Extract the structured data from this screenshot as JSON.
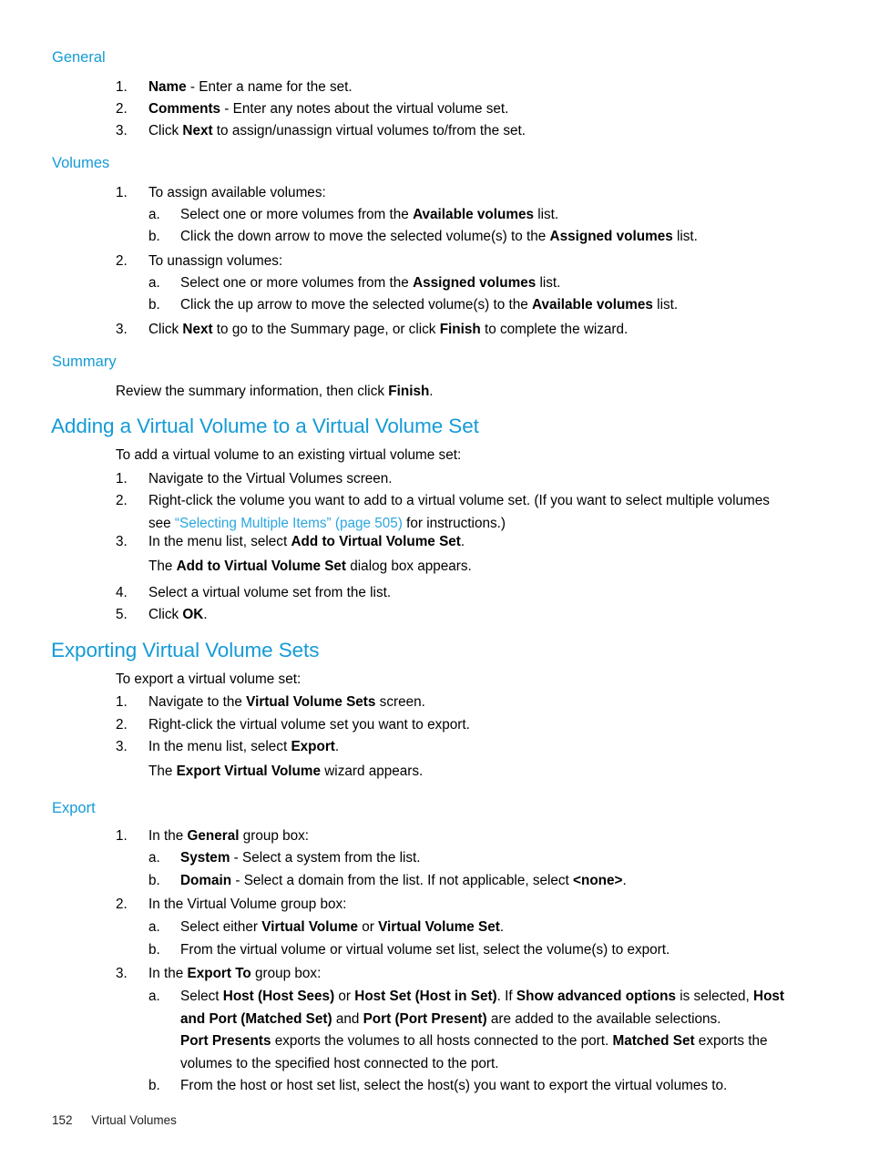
{
  "document": {
    "footer": {
      "page_number": "152",
      "chapter": "Virtual Volumes"
    }
  },
  "sections": [
    {
      "id": "general",
      "heading": "General",
      "items": [
        {
          "marker": "1.",
          "text_html": "<b>Name</b> - Enter a name for the set."
        },
        {
          "marker": "2.",
          "text_html": "<b>Comments</b> - Enter any notes about the virtual volume set."
        },
        {
          "marker": "3.",
          "text_html": "Click <b>Next</b> to assign/unassign virtual volumes to/from the set."
        }
      ]
    },
    {
      "id": "volumes",
      "heading": "Volumes",
      "items": [
        {
          "marker": "1.",
          "text_html": "To assign available volumes:"
        },
        {
          "marker": "a.",
          "text_html": "Select one or more volumes from the <b>Available volumes</b> list."
        },
        {
          "marker": "b.",
          "text_html": "Click the down arrow to move the selected volume(s) to the <b>Assigned volumes</b> list."
        },
        {
          "marker": "2.",
          "text_html": "To unassign volumes:"
        },
        {
          "marker": "a.",
          "text_html": "Select one or more volumes from the <b>Assigned volumes</b> list."
        },
        {
          "marker": "b.",
          "text_html": "Click the up arrow to move the selected volume(s) to the <b>Available volumes</b> list."
        },
        {
          "marker": "3.",
          "text_html": "Click <b>Next</b> to go to the Summary page, or click <b>Finish</b> to complete the wizard."
        }
      ]
    },
    {
      "id": "summary",
      "heading": "Summary",
      "body": "Review the summary information, then click <b>Finish</b>."
    },
    {
      "id": "adding-a-virtual-volume",
      "title": "Adding a Virtual Volume to a Virtual Volume Set",
      "intro": "To add a virtual volume to an existing virtual volume set:",
      "items": [
        {
          "marker": "1.",
          "text_html": "Navigate to the Virtual Volumes screen."
        },
        {
          "marker": "2.",
          "text_html": "Right-click the volume you want to add to a virtual volume set. (If you want to select multiple volumes see <span class=\"link\">&#8220;Selecting Multiple Items&#8221; (page 505)</span> for instructions.)"
        },
        {
          "marker": "3.",
          "text_html": "In the menu list, select <b>Add to Virtual Volume Set</b>."
        },
        {
          "marker": "",
          "text_html": "The <b>Add to Virtual Volume Set</b> dialog box appears."
        },
        {
          "marker": "4.",
          "text_html": "Select a virtual volume set from the list."
        },
        {
          "marker": "5.",
          "text_html": "Click <b>OK</b>."
        }
      ],
      "link_text": "“Selecting Multiple Items” (page 505)"
    },
    {
      "id": "exporting-virtual-volume-sets",
      "title": "Exporting Virtual Volume Sets",
      "intro": "To export a virtual volume set:",
      "items": [
        {
          "marker": "1.",
          "text_html": "Navigate to the <b>Virtual Volume Sets</b> screen."
        },
        {
          "marker": "2.",
          "text_html": "Right-click the virtual volume set you want to export."
        },
        {
          "marker": "3.",
          "text_html": "In the menu list, select <b>Export</b>."
        },
        {
          "marker": "",
          "text_html": "The <b>Export Virtual Volume</b> wizard appears."
        }
      ]
    },
    {
      "id": "export",
      "heading": "Export",
      "items": [
        {
          "marker": "1.",
          "text_html": "In the <b>General</b> group box:"
        },
        {
          "marker": "a.",
          "text_html": "<b>System</b> - Select a system from the list."
        },
        {
          "marker": "b.",
          "text_html": "<b>Domain</b> - Select a domain from the list. If not applicable, select <b>&lt;none&gt;</b>."
        },
        {
          "marker": "2.",
          "text_html": "In the Virtual Volume group box:"
        },
        {
          "marker": "a.",
          "text_html": "Select either <b>Virtual Volume</b> or <b>Virtual Volume Set</b>."
        },
        {
          "marker": "b.",
          "text_html": "From the virtual volume or virtual volume set list, select the volume(s) to export."
        },
        {
          "marker": "3.",
          "text_html": "In the <b>Export To</b> group box:"
        },
        {
          "marker": "a.",
          "text_html": "Select <b>Host (Host Sees)</b> or <b>Host Set (Host in Set)</b>. If <b>Show advanced options</b> is selected, <b>Host and Port (Matched Set)</b> and <b>Port (Port Present)</b> are added to the available selections."
        },
        {
          "marker": "",
          "text_html": "<b>Port Presents</b> exports the volumes to all hosts connected to the port. <b>Matched Set</b> exports the volumes to the specified host connected to the port."
        },
        {
          "marker": "b.",
          "text_html": "From the host or host set list, select the host(s) you want to export the virtual volumes to."
        }
      ]
    }
  ],
  "colors": {
    "heading_blue": "#159bd7",
    "link_blue": "#2ba6e0",
    "body_text": "#000000"
  }
}
